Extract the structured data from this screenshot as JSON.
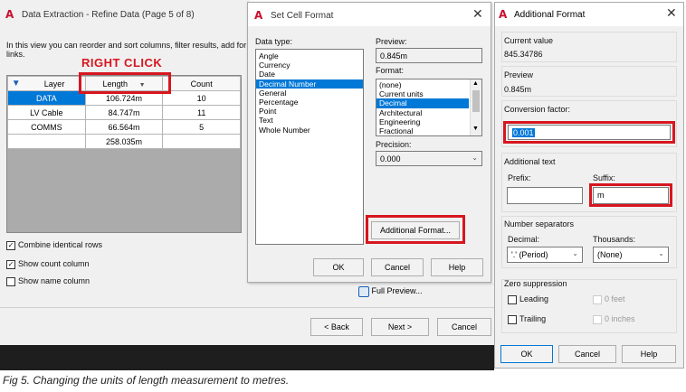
{
  "extraction": {
    "title": "Data Extraction - Refine Data (Page 5 of 8)",
    "intro": "In this view you can reorder and sort columns, filter results, add for",
    "intro2": "links.",
    "annotation": "RIGHT CLICK",
    "columns": [
      "Layer",
      "Length",
      "Count"
    ],
    "rows": [
      {
        "layer": "DATA",
        "length": "106.724m",
        "count": "10"
      },
      {
        "layer": "LV Cable",
        "length": "84.747m",
        "count": "11"
      },
      {
        "layer": "COMMS",
        "length": "66.564m",
        "count": "5"
      },
      {
        "layer": "",
        "length": "258.035m",
        "count": ""
      }
    ],
    "checkboxes": [
      {
        "label": "Combine identical rows",
        "checked": true
      },
      {
        "label": "Show count column",
        "checked": true
      },
      {
        "label": "Show name column",
        "checked": false
      }
    ],
    "full_preview": "Full Preview...",
    "back": "< Back",
    "next": "Next >",
    "cancel": "Cancel"
  },
  "cell_format": {
    "title": "Set Cell Format",
    "data_type_label": "Data type:",
    "data_types": [
      "Angle",
      "Currency",
      "Date",
      "Decimal Number",
      "General",
      "Percentage",
      "Point",
      "Text",
      "Whole Number"
    ],
    "selected_data_type": "Decimal Number",
    "preview_label": "Preview:",
    "preview_value": "0.845m",
    "format_label": "Format:",
    "formats": [
      "(none)",
      "Current units",
      "Decimal",
      "Architectural",
      "Engineering",
      "Fractional"
    ],
    "selected_format": "Decimal",
    "precision_label": "Precision:",
    "precision_value": "0.000",
    "additional_format": "Additional Format...",
    "ok": "OK",
    "cancel": "Cancel",
    "help": "Help"
  },
  "additional_format": {
    "title": "Additional Format",
    "current_value_label": "Current value",
    "current_value": "845.34786",
    "preview_label": "Preview",
    "preview_value": "0.845m",
    "conversion_label": "Conversion factor:",
    "conversion_value": "0.001",
    "additional_text_label": "Additional text",
    "prefix_label": "Prefix:",
    "prefix_value": "",
    "suffix_label": "Suffix:",
    "suffix_value": "m",
    "number_separators_label": "Number separators",
    "decimal_label": "Decimal:",
    "decimal_value": "'.' (Period)",
    "thousands_label": "Thousands:",
    "thousands_value": "(None)",
    "zero_suppression_label": "Zero suppression",
    "leading": "Leading",
    "trailing": "Trailing",
    "feet": "0 feet",
    "inches": "0 inches",
    "ok": "OK",
    "cancel": "Cancel",
    "help": "Help"
  },
  "caption": "Fig 5. Changing the units of length measurement to metres.",
  "colors": {
    "red": "#d7161f",
    "selection": "#0078d7"
  }
}
